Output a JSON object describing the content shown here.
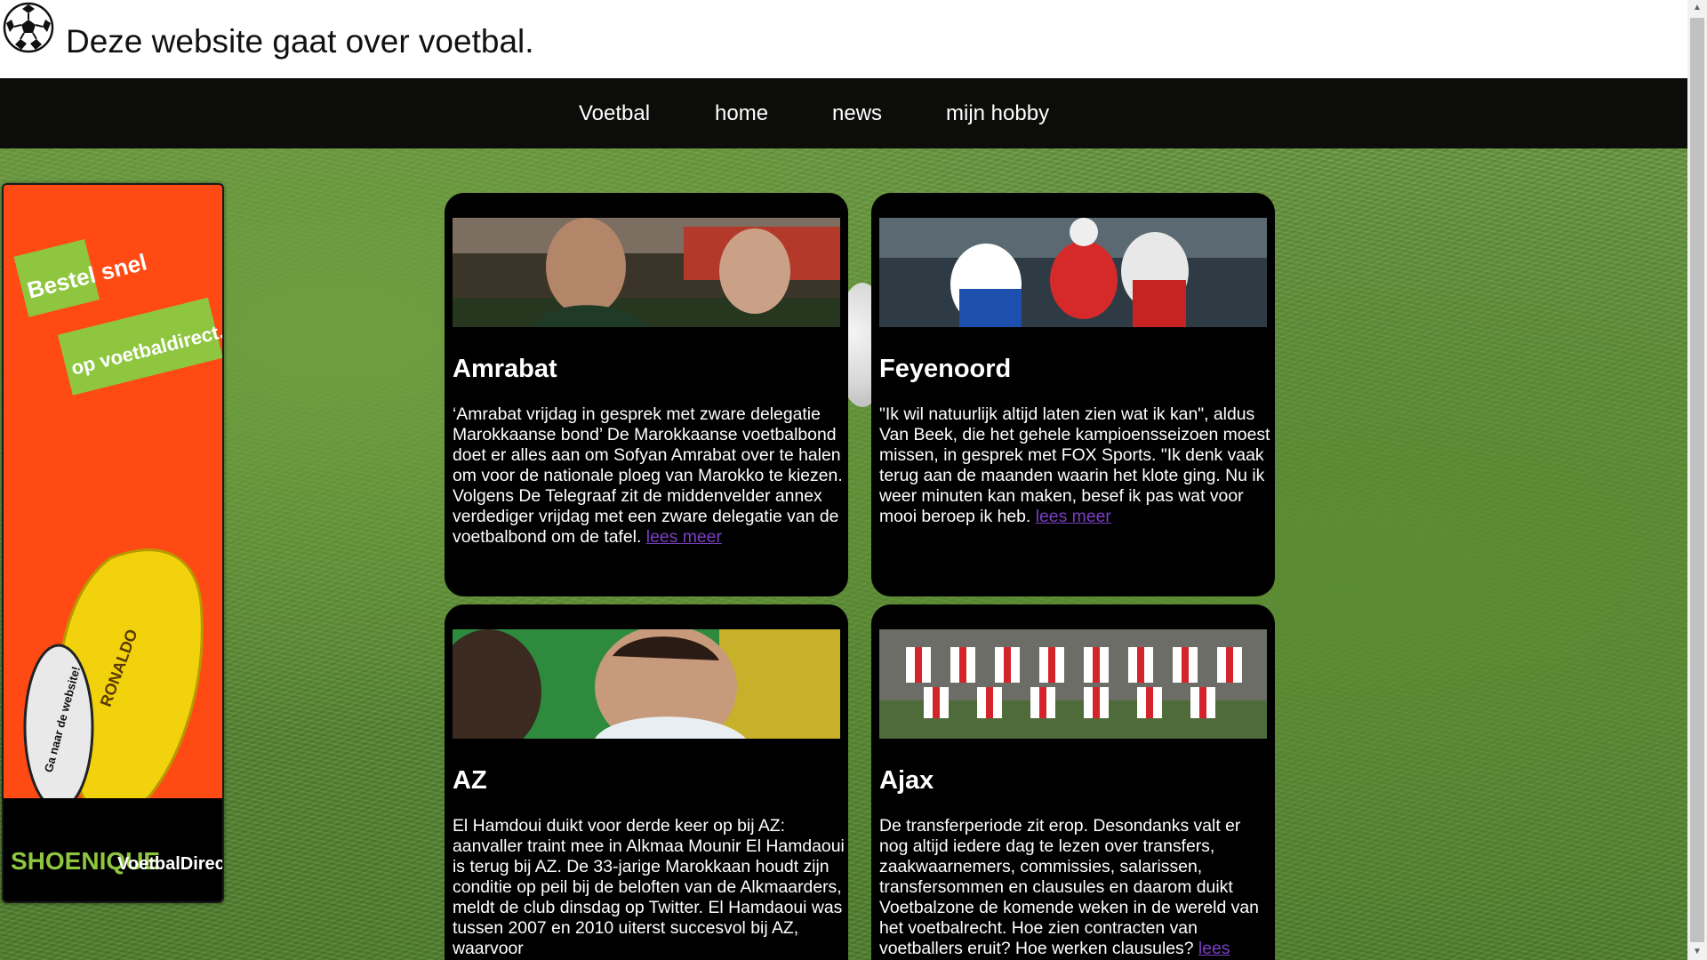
{
  "header": {
    "title": "Deze website gaat over voetbal."
  },
  "nav": {
    "items": [
      "Voetbal",
      "home",
      "news",
      "mijn hobby"
    ]
  },
  "ad": {
    "line1": "Bestel snel",
    "line2": "op voetbaldirect.nl",
    "cta": "Ga naar de website!",
    "shoe_text": "RONALDO",
    "brand1": "SHOENIQUE",
    "brand2": "VoetbalDirect"
  },
  "cards": [
    {
      "title": "Amrabat",
      "text": "‘Amrabat vrijdag in gesprek met zware delegatie Marokkaanse bond’ De Marokkaanse voetbalbond doet er alles aan om Sofyan Amrabat over te halen om voor de nationale ploeg van Marokko te kiezen. Volgens De Telegraaf zit de middenvelder annex verdediger vrijdag met een zware delegatie van de voetbalbond om de tafel.",
      "link": "lees meer"
    },
    {
      "title": "Feyenoord",
      "text": "\"Ik wil natuurlijk altijd laten zien wat ik kan\", aldus Van Beek, die het gehele kampioensseizoen moest missen, in gesprek met FOX Sports. \"Ik denk vaak terug aan de maanden waarin het klote ging. Nu ik weer minuten kan maken, besef ik pas wat voor mooi beroep ik heb.",
      "link": "lees meer"
    },
    {
      "title": "AZ",
      "text": "El Hamdoui duikt voor derde keer op bij AZ: aanvaller traint mee in Alkmaa Mounir El Hamdaoui is terug bij AZ. De 33-jarige Marokkaan houdt zijn conditie op peil bij de beloften van de Alkmaarders, meldt de club dinsdag op Twitter. El Hamdaoui was tussen 2007 en 2010 uiterst succesvol bij AZ, waarvoor",
      "link": ""
    },
    {
      "title": "Ajax",
      "text": "De transferperiode zit erop. Desondanks valt er nog altijd iedere dag te lezen over transfers, zaakwaarnemers, commissies, salarissen, transfersommen en clausules en daarom duikt Voetbalzone de komende weken in de wereld van het voetbalrecht. Hoe zien contracten van voetballers eruit? Hoe werken clausules?",
      "link": "lees"
    }
  ]
}
